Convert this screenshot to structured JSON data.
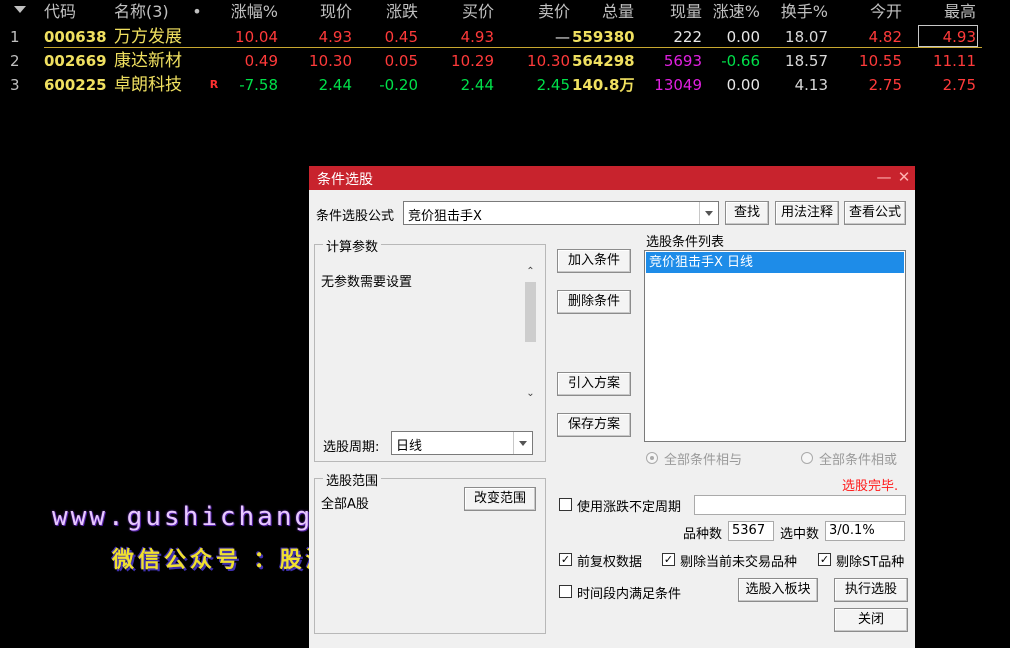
{
  "columns": {
    "code": "代码",
    "name": "名称(3)",
    "dot": "•",
    "change_pct": "涨幅%",
    "price": "现价",
    "change": "涨跌",
    "bid": "买价",
    "ask": "卖价",
    "volume": "总量",
    "cur_vol": "现量",
    "speed": "涨速%",
    "turnover": "换手%",
    "open": "今开",
    "high": "最高"
  },
  "rows": [
    {
      "idx": "1",
      "code": "000638",
      "name": "万方发展",
      "flag": "",
      "change_pct": "10.04",
      "price": "4.93",
      "change": "0.45",
      "bid": "4.93",
      "ask": "—",
      "volume": "559380",
      "cur_vol": "222",
      "speed": "0.00",
      "turnover": "18.07",
      "open": "4.82",
      "high": "4.93"
    },
    {
      "idx": "2",
      "code": "002669",
      "name": "康达新材",
      "flag": "",
      "change_pct": "0.49",
      "price": "10.30",
      "change": "0.05",
      "bid": "10.29",
      "ask": "10.30",
      "volume": "564298",
      "cur_vol": "5693",
      "speed": "-0.66",
      "turnover": "18.57",
      "open": "10.55",
      "high": "11.11"
    },
    {
      "idx": "3",
      "code": "600225",
      "name": "卓朗科技",
      "flag": "R",
      "change_pct": "-7.58",
      "price": "2.44",
      "change": "-0.20",
      "bid": "2.44",
      "ask": "2.45",
      "volume": "140.8万",
      "cur_vol": "13049",
      "speed": "0.00",
      "turnover": "4.13",
      "open": "2.75",
      "high": "2.75"
    }
  ],
  "dialog": {
    "title": "条件选股",
    "formula_label": "条件选股公式",
    "formula_value": "竞价狙击手X",
    "find_button": "查找",
    "usage_button": "用法注释",
    "view_button": "查看公式",
    "params_group": "计算参数",
    "params_text": "无参数需要设置",
    "add_button": "加入条件",
    "delete_button": "删除条件",
    "import_button": "引入方案",
    "save_button": "保存方案",
    "list_label": "选股条件列表",
    "list_items": [
      "竞价狙击手X  日线"
    ],
    "period_label": "选股周期:",
    "period_value": "日线",
    "radio_and": "全部条件相与",
    "radio_or": "全部条件相或",
    "range_group": "选股范围",
    "range_value": "全部A股",
    "change_range_button": "改变范围",
    "status_text": "选股完毕.",
    "use_period_label": "使用涨跌不定周期",
    "count_label": "品种数",
    "count_value": "5367",
    "selected_label": "选中数",
    "selected_value": "3/0.1%",
    "opt_adjust": "前复权数据",
    "opt_exclude_untraded": "剔除当前未交易品种",
    "opt_exclude_st": "剔除ST品种",
    "opt_time_range": "时间段内满足条件",
    "to_block_button": "选股入板块",
    "execute_button": "执行选股",
    "close_button": "关闭"
  },
  "watermark": {
    "url": "www.gushichanghong.com",
    "wechat": "微信公众号 ：股海操作手"
  },
  "colors": {
    "title_bar": "#c8232d",
    "up": "#ff3a3a",
    "down": "#00e04a",
    "selection": "#1e8ce8"
  }
}
